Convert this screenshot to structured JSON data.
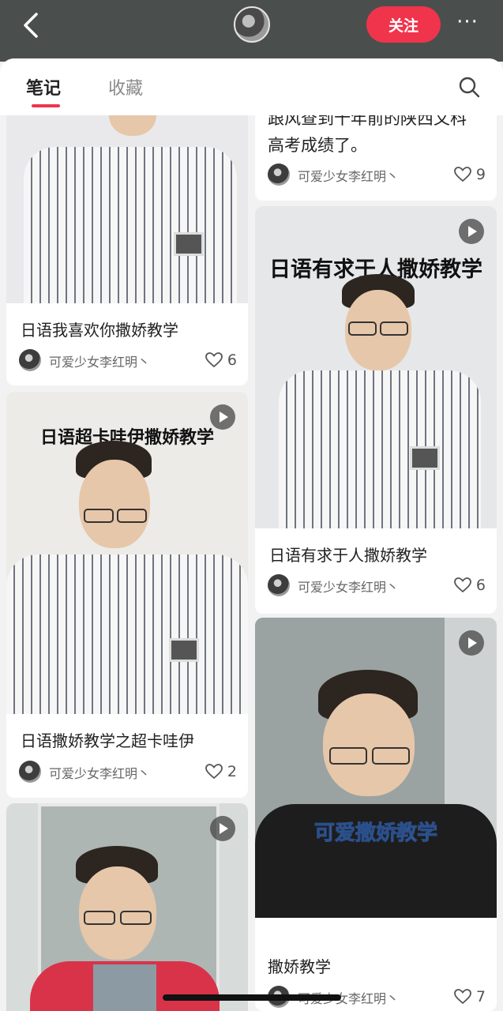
{
  "topbar": {
    "follow_label": "关注",
    "more_label": "···"
  },
  "tabs": {
    "notes": "笔记",
    "favorites": "收藏"
  },
  "cards": {
    "c1": {
      "title": "日语我喜欢你撒娇教学",
      "author": "可爱少女李红明丶",
      "likes": "6"
    },
    "c2": {
      "title_line1": "跟风查到十年前的陕西文科",
      "title_line2": "高考成绩了。",
      "author": "可爱少女李红明丶",
      "likes": "9"
    },
    "c3": {
      "overlay": "日语有求于人撒娇教学",
      "title": "日语有求于人撒娇教学",
      "author": "可爱少女李红明丶",
      "likes": "6"
    },
    "c4": {
      "overlay": "日语超卡哇伊撒娇教学",
      "title": "日语撒娇教学之超卡哇伊",
      "author": "可爱少女李红明丶",
      "likes": "2"
    },
    "c5": {
      "overlay": "可爱撒娇教学",
      "title": "撒娇教学",
      "author": "可爱少女李红明丶",
      "likes": "7"
    }
  },
  "colors": {
    "accent": "#f0344c",
    "topbar": "#4a4f4d",
    "overlay_blue": "#8fb7f5"
  }
}
